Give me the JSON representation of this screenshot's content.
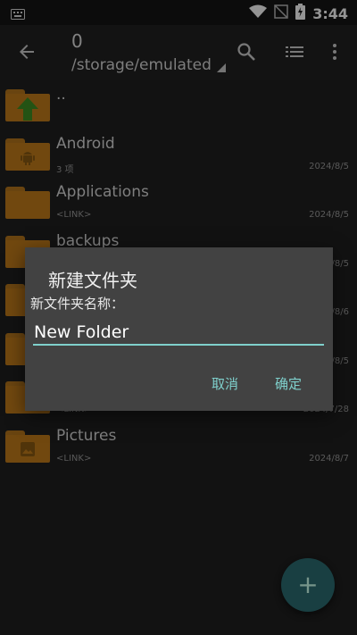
{
  "status": {
    "time": "3:44"
  },
  "appbar": {
    "count": "0",
    "path": "/storage/emulated"
  },
  "files": [
    {
      "name": "..",
      "sub": "",
      "date": "",
      "icon": "up-arrow-icon"
    },
    {
      "name": "Android",
      "sub": "3 项",
      "date": "2024/8/5",
      "icon": "android-icon"
    },
    {
      "name": "Applications",
      "sub": "<LINK>",
      "date": "2024/8/5",
      "icon": ""
    },
    {
      "name": "backups",
      "sub": "",
      "date": "2024/8/5",
      "icon": ""
    },
    {
      "name": "",
      "sub": "",
      "date": "2024/8/6",
      "icon": ""
    },
    {
      "name": "",
      "sub": "",
      "date": "2024/8/5",
      "icon": ""
    },
    {
      "name": "",
      "sub": "<LINK>",
      "date": "2024/7/28",
      "icon": ""
    },
    {
      "name": "Pictures",
      "sub": "<LINK>",
      "date": "2024/8/7",
      "icon": "image-icon"
    }
  ],
  "dialog": {
    "title": "新建文件夹",
    "label": "新文件夹名称：",
    "input_value": "New Folder",
    "cancel": "取消",
    "ok": "确定"
  },
  "colors": {
    "accent": "#7fd0cc",
    "folder": "#c37d1b",
    "fab": "#2b6d72"
  }
}
